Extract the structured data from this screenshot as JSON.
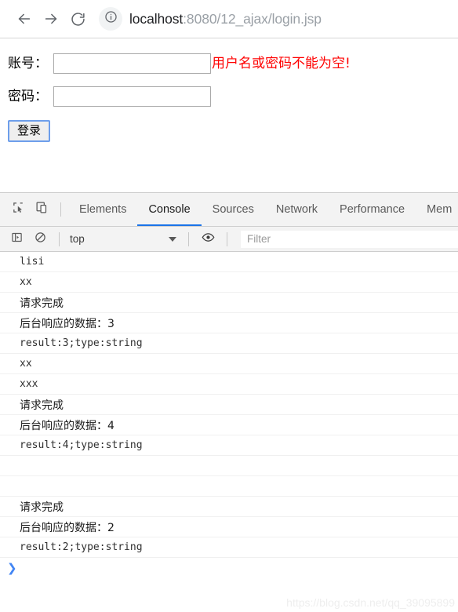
{
  "browser": {
    "back_icon": "arrow-left-icon",
    "forward_icon": "arrow-right-icon",
    "reload_icon": "reload-icon",
    "info_icon": "info-circle-icon",
    "url_host": "localhost",
    "url_path": ":8080/12_ajax/login.jsp"
  },
  "page": {
    "account_label": "账号：",
    "account_value": "",
    "password_label": "密码：",
    "password_value": "",
    "error_message": "用户名或密码不能为空!",
    "login_label": "登录",
    "error_color": "#ff0000",
    "focus_color": "#6d9eeb"
  },
  "devtools": {
    "inspect_icon": "inspect-element-icon",
    "device_icon": "device-toolbar-icon",
    "tabs": [
      {
        "label": "Elements",
        "active": false
      },
      {
        "label": "Console",
        "active": true
      },
      {
        "label": "Sources",
        "active": false
      },
      {
        "label": "Network",
        "active": false
      },
      {
        "label": "Performance",
        "active": false
      },
      {
        "label": "Mem",
        "active": false
      }
    ],
    "active_tab_color": "#1a73e8",
    "filterbar": {
      "sidebar_icon": "console-sidebar-icon",
      "clear_icon": "clear-console-icon",
      "context": "top",
      "caret_icon": "chevron-down-icon",
      "eye_icon": "eye-icon",
      "filter_placeholder": "Filter",
      "filter_value": ""
    },
    "console_rows": [
      {
        "text": "lisi",
        "style": "mono"
      },
      {
        "text": "xx",
        "style": "mono"
      },
      {
        "text": "请求完成",
        "style": "cjk"
      },
      {
        "text": "后台响应的数据：3",
        "style": "cjk"
      },
      {
        "text": "result:3;type:string",
        "style": "mono"
      },
      {
        "text": "xx",
        "style": "mono"
      },
      {
        "text": "xxx",
        "style": "mono"
      },
      {
        "text": "请求完成",
        "style": "cjk"
      },
      {
        "text": "后台响应的数据：4",
        "style": "cjk"
      },
      {
        "text": "result:4;type:string",
        "style": "mono"
      },
      {
        "text": "",
        "style": "blank"
      },
      {
        "text": "",
        "style": "blank"
      },
      {
        "text": "请求完成",
        "style": "cjk"
      },
      {
        "text": "后台响应的数据：2",
        "style": "cjk"
      },
      {
        "text": "result:2;type:string",
        "style": "mono"
      }
    ],
    "prompt_symbol": "❯"
  },
  "watermark": "https://blog.csdn.net/qq_39095899"
}
